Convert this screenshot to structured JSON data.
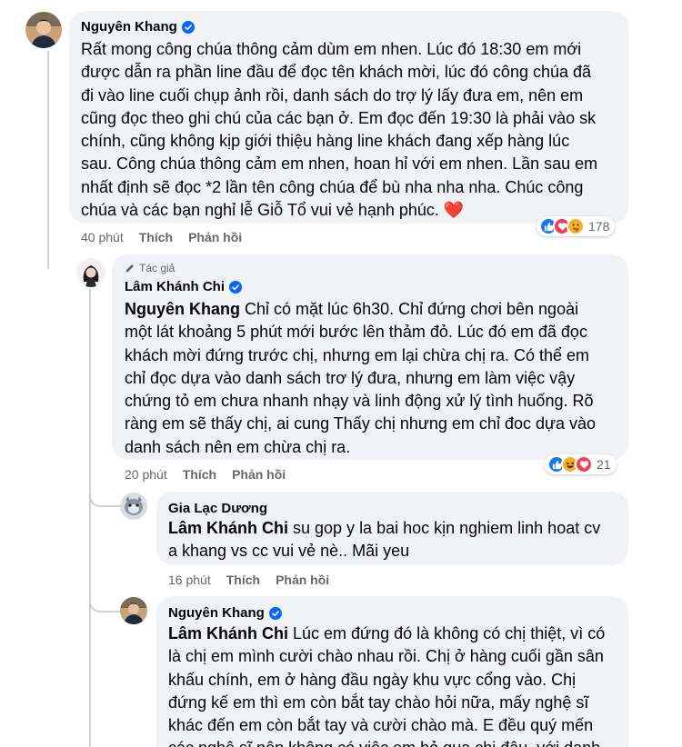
{
  "comments": [
    {
      "author": "Nguyên Khang",
      "author_badge": "",
      "mention": "",
      "lines": [
        "Rất mong công chúa thông cảm dùm em nhen. Lúc đó 18:30 em mới",
        "được dẫn ra phần line đầu để đọc tên khách mời, lúc đó công chúa đã",
        "đi vào line cuối chụp ảnh rồi, danh sách do trợ lý lấy đưa em, nên em",
        "cũng đọc theo ghi chú của các bạn ở. Em đọc đến 19:30 là phải vào sk",
        "chính, cũng không kịp giới thiệu hàng line khách đang xếp hàng lúc",
        "sau. Công chúa thông cảm em nhen, hoan hỉ với em nhen. Lần sau em",
        "nhất định sẽ đọc *2 lần tên công chúa để bù nha nha nha. Chúc công",
        "chúa và các bạn nghỉ lễ Giỗ Tổ vui vẻ hạnh phúc. ❤️"
      ],
      "time": "40 phút",
      "like": "Thích",
      "reply": "Phản hồi",
      "reaction_count": "178"
    },
    {
      "author": "Lâm Khánh Chi",
      "author_badge": "Tác giả",
      "mention": "Nguyên Khang",
      "lines": [
        " Chỉ có mặt lúc 6h30. Chỉ đứng chơi bên ngoài",
        "một lát khoảng 5 phút mới bước lên thảm đỏ. Lúc đó em đã đọc",
        "khách mời đứng trước chị, nhưng em lại chừa chị ra. Có thể em",
        "chỉ đọc dựa vào danh sách trơ lý đưa, nhưng em làm việc vậy",
        "chứng tỏ em chưa nhanh nhạy và linh động xử lý tình huống. Rõ",
        "ràng em sẽ thấy chị, ai cung Thấy chị nhưng em chỉ đoc dựa vào",
        "danh sách nên em chừa chị ra."
      ],
      "time": "20 phút",
      "like": "Thích",
      "reply": "Phản hồi",
      "reaction_count": "21"
    },
    {
      "author": "Gia Lạc Dương",
      "mention": "Lâm Khánh Chi",
      "lines": [
        " su gop y la bai hoc kịn nghiem linh hoat cv",
        "a khang vs cc vui vẻ nè.. Mãi yeu"
      ],
      "time": "16 phút",
      "like": "Thích",
      "reply": "Phản hồi"
    },
    {
      "author": "Nguyên Khang",
      "mention": "Lâm Khánh Chi",
      "lines": [
        " Lúc em đứng đó là không có chị thiệt, vì có",
        "là chị em mình cười chào nhau rồi. Chị ở hàng cuối gần sân",
        "khấu chính, em ở hàng đầu ngày khu vực cổng vào. Chị",
        "đứng kế em thì em còn bắt tay chào hỏi nữa, mấy nghệ sĩ",
        "khác đến em còn bắt tay và cười chào mà. E đều quý mến",
        "các nghệ sĩ nên không có việc em bỏ qua chị đâu, với danh"
      ]
    }
  ],
  "icons": {
    "verified": "verified-badge-icon",
    "like": "like-reaction-icon",
    "love": "love-reaction-icon",
    "care": "care-reaction-icon",
    "haha": "haha-reaction-icon",
    "author_tag": "pencil-icon"
  },
  "colors": {
    "bubble": "#f0f2f5",
    "verified": "#0866ff",
    "like": "#1877f2",
    "love": "#f33e58",
    "meta": "#65676b"
  }
}
